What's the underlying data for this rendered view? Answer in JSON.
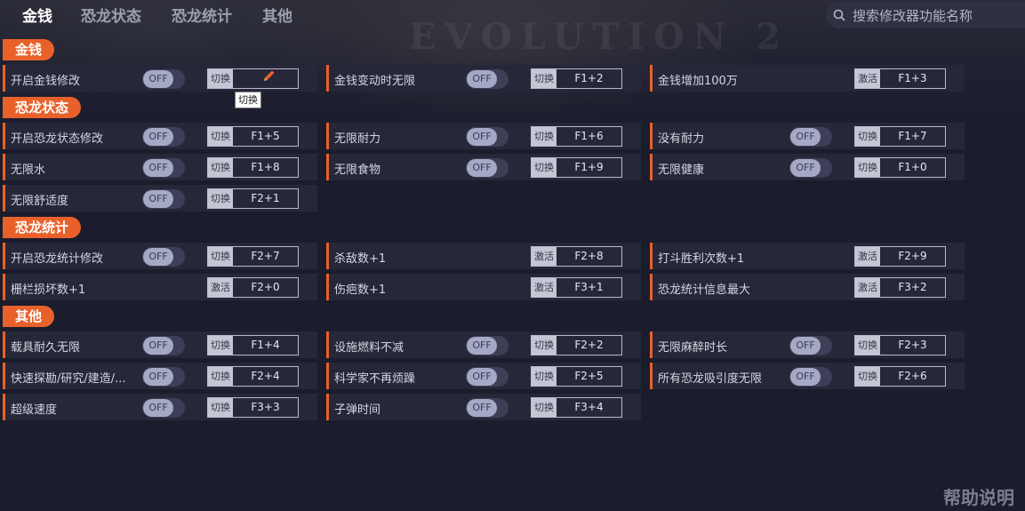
{
  "tabs": [
    {
      "label": "金钱"
    },
    {
      "label": "恐龙状态"
    },
    {
      "label": "恐龙统计"
    },
    {
      "label": "其他"
    }
  ],
  "search": {
    "placeholder": "搜索修改器功能名称"
  },
  "tooltip": "切换",
  "help": "帮助说明",
  "background_text": "EVOLUTION 2",
  "toggle_text": "OFF",
  "colors": {
    "accent": "#e9612a",
    "background": "#1b1c2c",
    "row": "#262839"
  },
  "sections": [
    {
      "title": "金钱"
    },
    {
      "title": "恐龙状态"
    },
    {
      "title": "恐龙统计"
    },
    {
      "title": "其他"
    }
  ],
  "rows": [
    {
      "label": "开启金钱修改",
      "toggle": "OFF",
      "mode": "切换",
      "key": "",
      "editing": true
    },
    {
      "label": "金钱变动时无限",
      "toggle": "OFF",
      "mode": "切换",
      "key": "F1+2"
    },
    {
      "label": "金钱增加100万",
      "mode": "激活",
      "key": "F1+3"
    },
    {
      "label": "开启恐龙状态修改",
      "toggle": "OFF",
      "mode": "切换",
      "key": "F1+5"
    },
    {
      "label": "无限耐力",
      "toggle": "OFF",
      "mode": "切换",
      "key": "F1+6"
    },
    {
      "label": "没有耐力",
      "toggle": "OFF",
      "mode": "切换",
      "key": "F1+7"
    },
    {
      "label": "无限水",
      "toggle": "OFF",
      "mode": "切换",
      "key": "F1+8"
    },
    {
      "label": "无限食物",
      "toggle": "OFF",
      "mode": "切换",
      "key": "F1+9"
    },
    {
      "label": "无限健康",
      "toggle": "OFF",
      "mode": "切换",
      "key": "F1+0"
    },
    {
      "label": "无限舒适度",
      "toggle": "OFF",
      "mode": "切换",
      "key": "F2+1"
    },
    {
      "label": "开启恐龙统计修改",
      "toggle": "OFF",
      "mode": "切换",
      "key": "F2+7"
    },
    {
      "label": "杀敌数+1",
      "mode": "激活",
      "key": "F2+8"
    },
    {
      "label": "打斗胜利次数+1",
      "mode": "激活",
      "key": "F2+9"
    },
    {
      "label": "栅栏损坏数+1",
      "mode": "激活",
      "key": "F2+0"
    },
    {
      "label": "伤疤数+1",
      "mode": "激活",
      "key": "F3+1"
    },
    {
      "label": "恐龙统计信息最大",
      "mode": "激活",
      "key": "F3+2"
    },
    {
      "label": "载具耐久无限",
      "toggle": "OFF",
      "mode": "切换",
      "key": "F1+4"
    },
    {
      "label": "设施燃料不减",
      "toggle": "OFF",
      "mode": "切换",
      "key": "F2+2"
    },
    {
      "label": "无限麻醉时长",
      "toggle": "OFF",
      "mode": "切换",
      "key": "F2+3"
    },
    {
      "label": "快速探勘/研究/建造/...",
      "toggle": "OFF",
      "mode": "切换",
      "key": "F2+4"
    },
    {
      "label": "科学家不再烦躁",
      "toggle": "OFF",
      "mode": "切换",
      "key": "F2+5"
    },
    {
      "label": "所有恐龙吸引度无限",
      "toggle": "OFF",
      "mode": "切换",
      "key": "F2+6"
    },
    {
      "label": "超级速度",
      "toggle": "OFF",
      "mode": "切换",
      "key": "F3+3"
    },
    {
      "label": "子弹时间",
      "toggle": "OFF",
      "mode": "切换",
      "key": "F3+4"
    }
  ]
}
